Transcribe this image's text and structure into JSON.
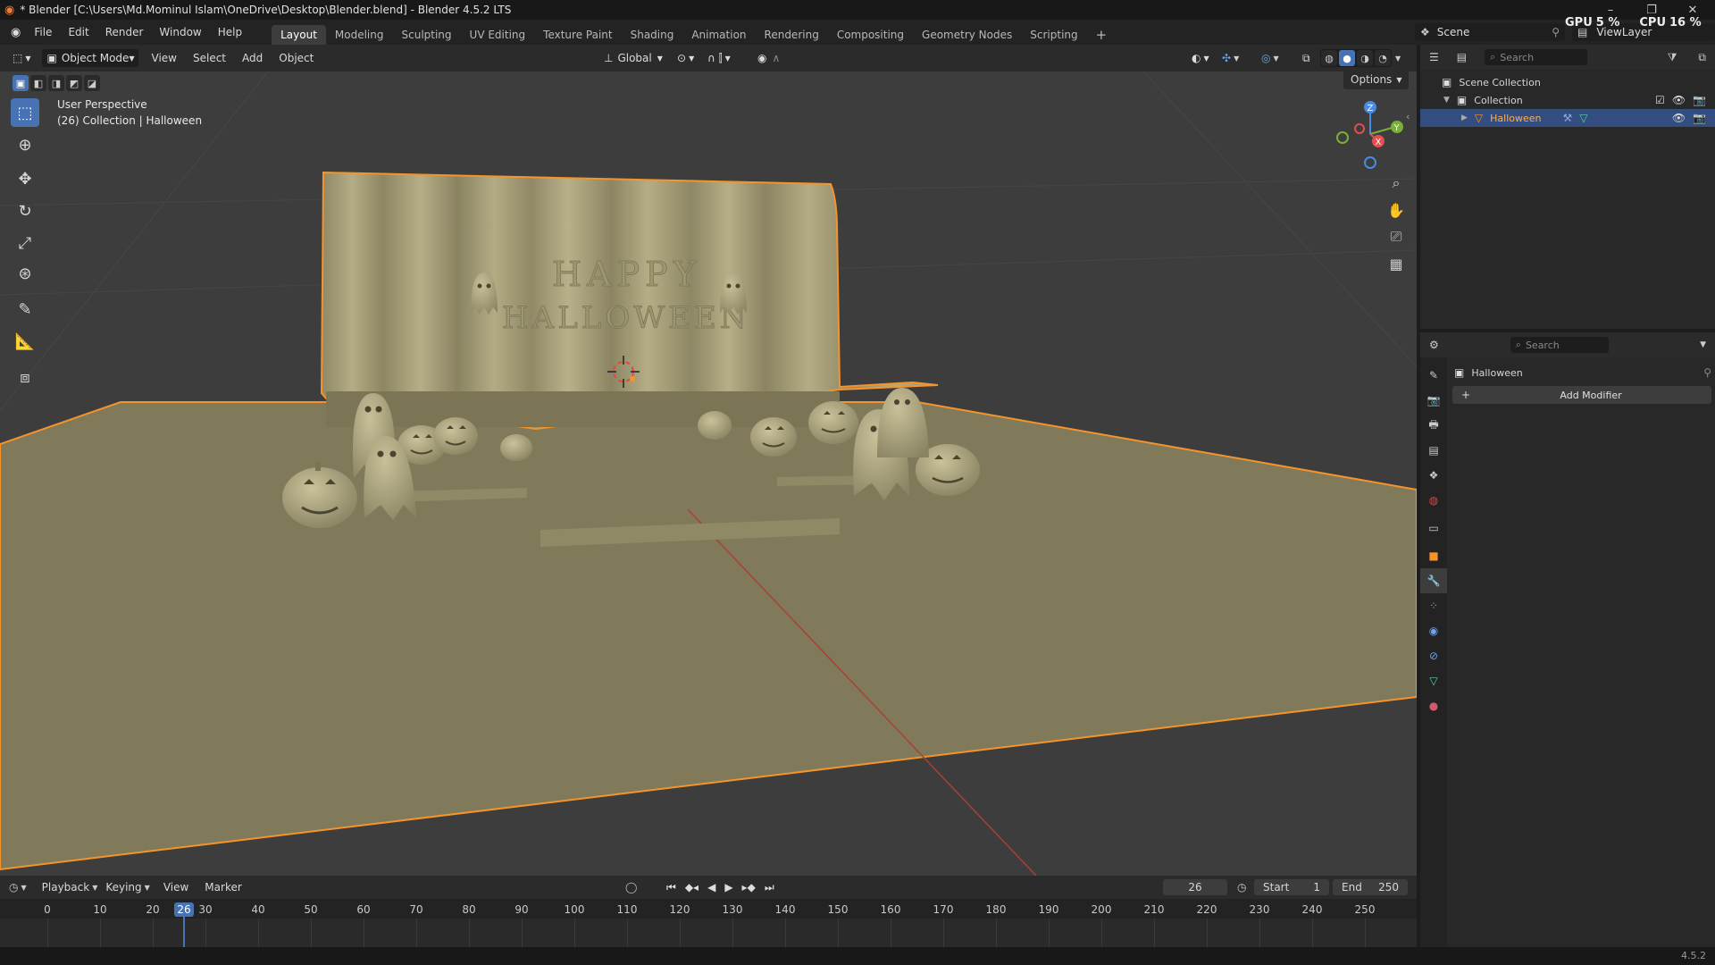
{
  "window": {
    "title": "* Blender [C:\\Users\\Md.Mominul Islam\\OneDrive\\Desktop\\Blender.blend] - Blender 4.5.2 LTS",
    "controls": [
      "–",
      "❐",
      "✕"
    ]
  },
  "menu": [
    "File",
    "Edit",
    "Render",
    "Window",
    "Help"
  ],
  "workspaces": {
    "tabs": [
      "Layout",
      "Modeling",
      "Sculpting",
      "UV Editing",
      "Texture Paint",
      "Shading",
      "Animation",
      "Rendering",
      "Compositing",
      "Geometry Nodes",
      "Scripting"
    ],
    "active": "Layout",
    "add": "+"
  },
  "scene_selector": {
    "scene": "Scene",
    "view_layer": "ViewLayer"
  },
  "monitor": {
    "gpu_label": "GPU",
    "gpu_value": "5 %",
    "cpu_label": "CPU",
    "cpu_value": "16 %"
  },
  "viewport_header": {
    "mode": "Object Mode",
    "menus": [
      "View",
      "Select",
      "Add",
      "Object"
    ],
    "orientation": "Global",
    "options": "Options"
  },
  "viewport": {
    "perspective": "User Perspective",
    "collection_info": "(26) Collection | Halloween",
    "backdrop_text_line1": "HAPPY",
    "backdrop_text_line2": "HALLOWEEN",
    "gizmo": {
      "z": "Z",
      "y": "Y",
      "x": "X"
    },
    "colors": {
      "background": "#3d3d3d",
      "floor": "#807a5a",
      "model": "#aaa37b",
      "selection": "#f5942a"
    }
  },
  "outliner": {
    "search_placeholder": "Search",
    "scene_collection": "Scene Collection",
    "collection": "Collection",
    "object": "Halloween"
  },
  "properties": {
    "search_placeholder": "Search",
    "object_name": "Halloween",
    "add_modifier": "Add Modifier"
  },
  "timeline": {
    "menus": [
      "Playback",
      "Keying",
      "View",
      "Marker"
    ],
    "current_frame": "26",
    "start_label": "Start",
    "start_value": "1",
    "end_label": "End",
    "end_value": "250",
    "ruler": [
      "0",
      "10",
      "20",
      "30",
      "40",
      "50",
      "60",
      "70",
      "80",
      "90",
      "100",
      "110",
      "120",
      "130",
      "140",
      "150",
      "160",
      "170",
      "180",
      "190",
      "200",
      "210",
      "220",
      "230",
      "240",
      "250"
    ],
    "playhead": "26"
  },
  "status": {
    "version": "4.5.2"
  }
}
